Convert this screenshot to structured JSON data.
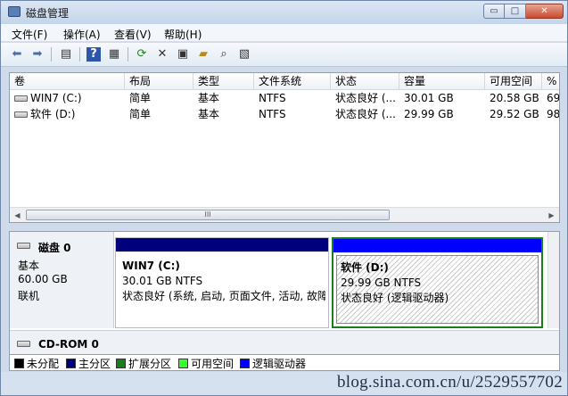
{
  "window": {
    "title": "磁盘管理",
    "buttons": {
      "minimize": "▭",
      "maximize": "□",
      "close": "✕"
    }
  },
  "menu": [
    "文件(F)",
    "操作(A)",
    "查看(V)",
    "帮助(H)"
  ],
  "toolbar_icons": [
    "back-arrow-icon",
    "forward-arrow-icon",
    "console-tree-icon",
    "help-icon",
    "help-topics-icon",
    "refresh-icon",
    "delete-icon",
    "properties-icon",
    "open-folder-icon",
    "search-icon",
    "export-icon"
  ],
  "volume_list": {
    "columns": [
      "卷",
      "布局",
      "类型",
      "文件系统",
      "状态",
      "容量",
      "可用空间",
      "%"
    ],
    "rows": [
      {
        "volume": "WIN7 (C:)",
        "layout": "简单",
        "type": "基本",
        "fs": "NTFS",
        "status": "状态良好 (...",
        "capacity": "30.01 GB",
        "free": "20.58 GB",
        "pct": "69"
      },
      {
        "volume": "软件 (D:)",
        "layout": "简单",
        "type": "基本",
        "fs": "NTFS",
        "status": "状态良好 (...",
        "capacity": "29.99 GB",
        "free": "29.52 GB",
        "pct": "98"
      }
    ],
    "scroll_thumb_label": "III"
  },
  "disks": [
    {
      "name": "磁盘 0",
      "kind": "基本",
      "size": "60.00 GB",
      "state": "联机",
      "partitions": [
        {
          "title": "WIN7 (C:)",
          "size_fs": "30.01 GB NTFS",
          "status": "状态良好 (系统, 启动, 页面文件, 活动, 故障",
          "bar_color": "#00007c"
        },
        {
          "title": "软件 (D:)",
          "size_fs": "29.99 GB NTFS",
          "status": "状态良好 (逻辑驱动器)",
          "bar_color": "#0000ff",
          "frame_color": "#1a7f1a"
        }
      ]
    },
    {
      "name": "CD-ROM 0"
    }
  ],
  "legend": [
    {
      "label": "未分配",
      "color": "#000000"
    },
    {
      "label": "主分区",
      "color": "#00007c"
    },
    {
      "label": "扩展分区",
      "color": "#1a7f1a"
    },
    {
      "label": "可用空间",
      "color": "#33ff33"
    },
    {
      "label": "逻辑驱动器",
      "color": "#0000ff"
    }
  ],
  "watermark": "blog.sina.com.cn/u/2529557702"
}
